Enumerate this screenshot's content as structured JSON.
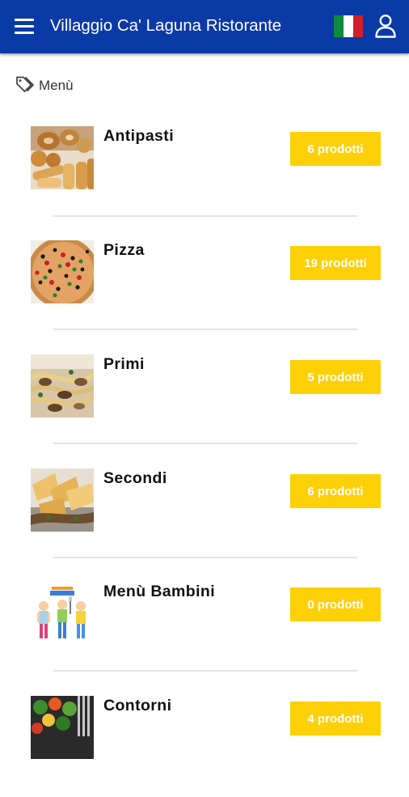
{
  "header": {
    "title": "Villaggio Ca' Laguna Ristorante",
    "flag": "italian-flag-icon",
    "user_icon": "user-icon"
  },
  "breadcrumb": {
    "icon": "tag-icon",
    "label": "Menù"
  },
  "categories": [
    {
      "name": "Antipasti",
      "count": "6 prodotti",
      "image": "antipasti-photo"
    },
    {
      "name": "Pizza",
      "count": "19 prodotti",
      "image": "pizza-photo"
    },
    {
      "name": "Primi",
      "count": "5 prodotti",
      "image": "primi-photo"
    },
    {
      "name": "Secondi",
      "count": "6 prodotti",
      "image": "secondi-photo"
    },
    {
      "name": "Menù Bambini",
      "count": "0 prodotti",
      "image": "kids-menu-illustration"
    },
    {
      "name": "Contorni",
      "count": "4 prodotti",
      "image": "contorni-photo"
    }
  ],
  "colors": {
    "header": "#0a3aa6",
    "badge": "#fdd008",
    "divider": "#e1e3f1"
  }
}
